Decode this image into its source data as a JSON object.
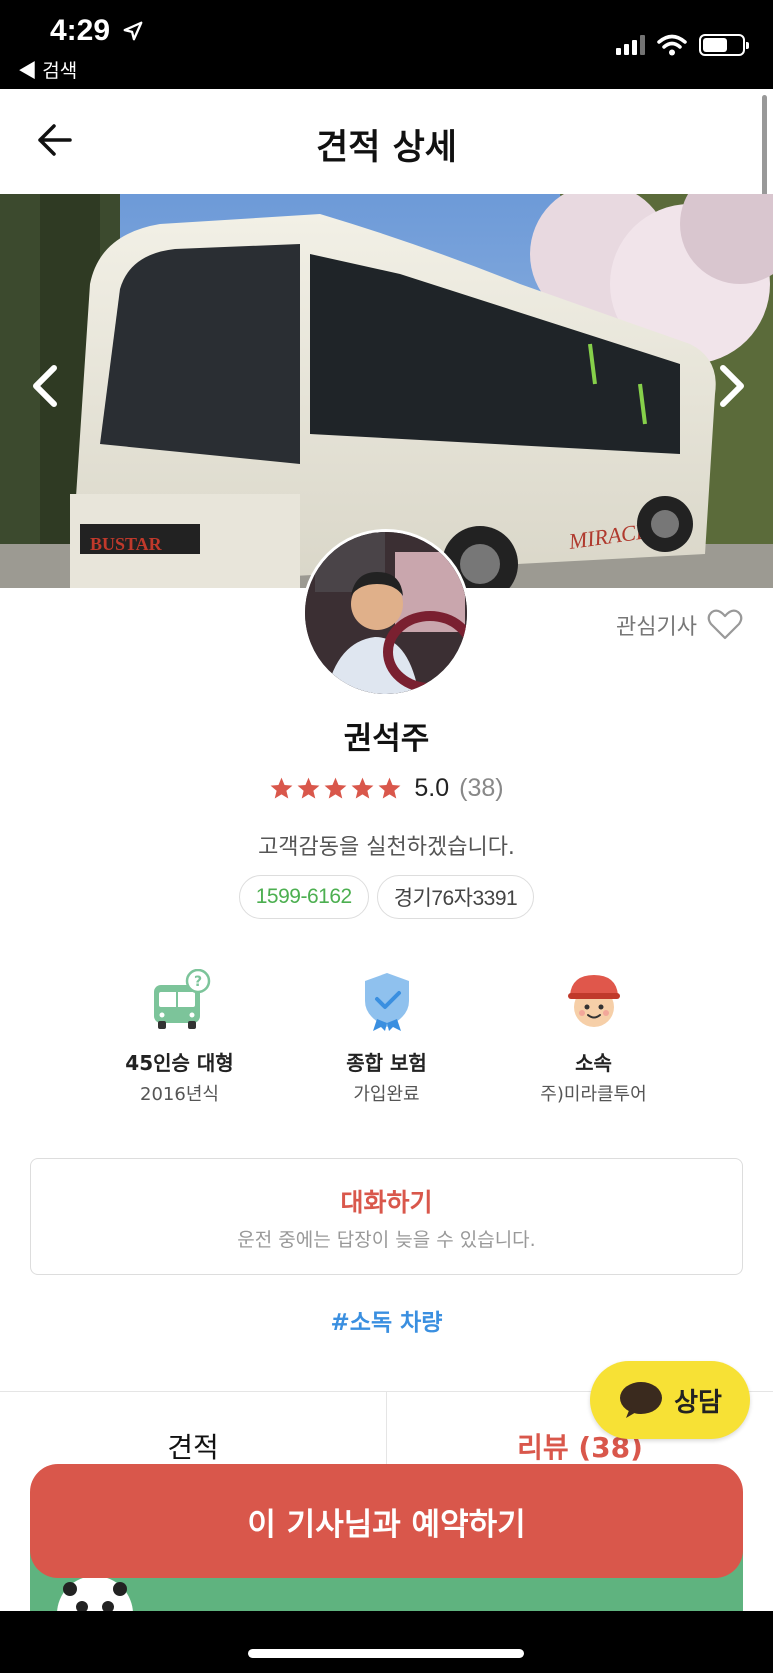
{
  "status_bar": {
    "time": "4:29",
    "back_app": "◀ 검색"
  },
  "header": {
    "title": "견적 상세"
  },
  "driver": {
    "favorite_label": "관심기사",
    "name": "권석주",
    "rating_score": "5.0",
    "rating_count": "(38)",
    "rating_stars": 5,
    "greeting": "고객감동을 실천하겠습니다.",
    "phone": "1599-6162",
    "plate": "경기76자3391"
  },
  "features": [
    {
      "icon": "bus-icon",
      "title": "45인승 대형",
      "sub": "2016년식"
    },
    {
      "icon": "insurance-shield-icon",
      "title": "종합 보험",
      "sub": "가입완료"
    },
    {
      "icon": "driver-cap-icon",
      "title": "소속",
      "sub": "주)미라클투어"
    }
  ],
  "chat": {
    "title": "대화하기",
    "subtitle": "운전 중에는 답장이 늦을 수 있습니다."
  },
  "hashtag": "#소독 차량",
  "tabs": {
    "quote": "견적",
    "review": "리뷰 (38)"
  },
  "kakao": {
    "label": "상담"
  },
  "cta": {
    "reserve": "이 기사님과 예약하기"
  },
  "colors": {
    "accent": "#d9574b",
    "phone": "#4caf50",
    "hashtag": "#3a8fe0",
    "kakao": "#f7e135"
  }
}
